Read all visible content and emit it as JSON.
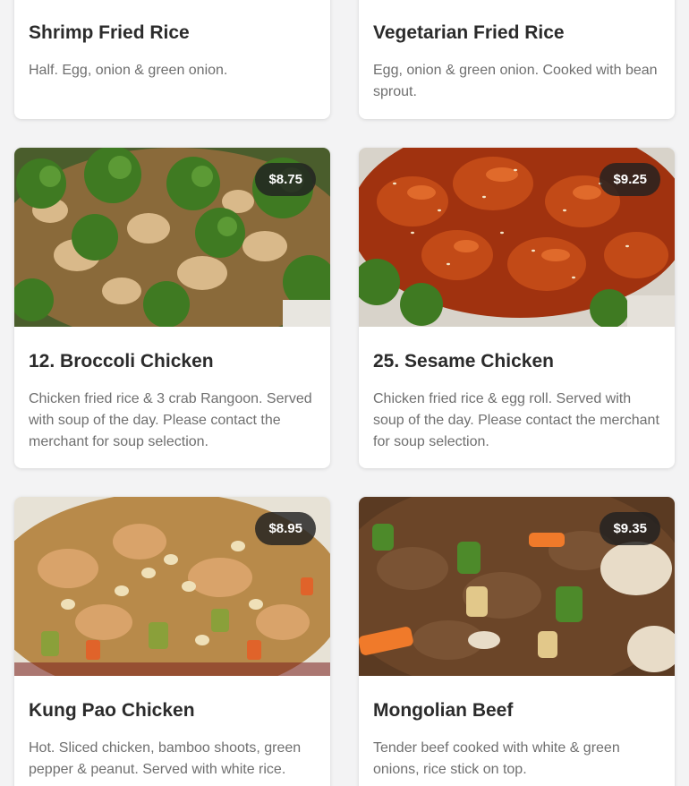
{
  "menu_items": [
    {
      "name": "Shrimp Fried Rice",
      "description": "Half. Egg, onion & green onion."
    },
    {
      "name": "Vegetarian Fried Rice",
      "description": "Egg, onion & green onion. Cooked with bean sprout."
    },
    {
      "name": "12. Broccoli Chicken",
      "description": "Chicken fried rice & 3 crab Rangoon. Served with soup of the day. Please contact the merchant for soup selection.",
      "price": "$8.75"
    },
    {
      "name": "25. Sesame Chicken",
      "description": "Chicken fried rice & egg roll. Served with soup of the day. Please contact the merchant for soup selection.",
      "price": "$9.25"
    },
    {
      "name": "Kung Pao Chicken",
      "description": "Hot. Sliced chicken, bamboo shoots, green pepper & peanut. Served with white rice.",
      "price": "$8.95"
    },
    {
      "name": "Mongolian Beef",
      "description": "Tender beef cooked with white & green onions, rice stick on top.",
      "price": "$9.35"
    }
  ],
  "colors": {
    "page_background": "#f3f3f4",
    "card_background": "#ffffff",
    "price_badge_background": "#212121",
    "title_text": "#2b2b2b",
    "description_text": "#6f6f6f"
  }
}
